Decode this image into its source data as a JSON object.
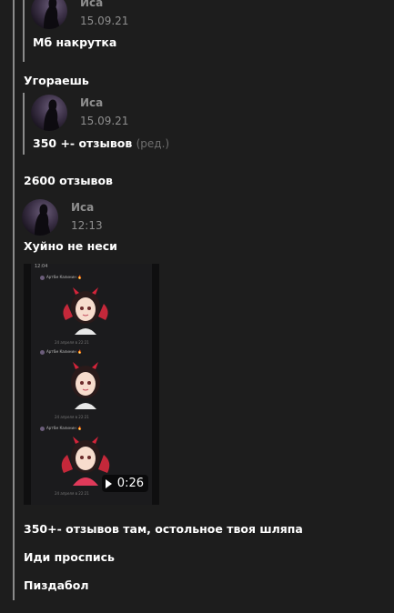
{
  "messages": {
    "q1": {
      "author": "Иса",
      "time": "15.09.21",
      "text": "Мб накрутка"
    },
    "m1": {
      "text": "Угораешь"
    },
    "q2": {
      "author": "Иса",
      "time": "15.09.21",
      "text": "350 +- отзывов",
      "edited": "(ред.)"
    },
    "m2": {
      "text": "2600 отзывов"
    },
    "m3": {
      "author": "Иса",
      "time": "12:13",
      "text": "Хуйно не неси"
    },
    "video": {
      "duration": "0:26",
      "clock": "12:04",
      "sticker_author": "Арт6м Калинин 🔥",
      "sticker_dates": [
        "24 апреля в 22:21",
        "24 апреля в 22:21",
        "24 апреля в 22:21"
      ]
    },
    "m4": {
      "text": "350+- отзывов там, остольное твоя шляпа"
    },
    "m5": {
      "text": "Иди проспись"
    },
    "m6": {
      "text": "Пиздабол"
    }
  },
  "colors": {
    "background": "#1d1d1d",
    "text": "#ffffff",
    "muted": "#8e8e8e",
    "thread_line": "#8a8a8a"
  }
}
